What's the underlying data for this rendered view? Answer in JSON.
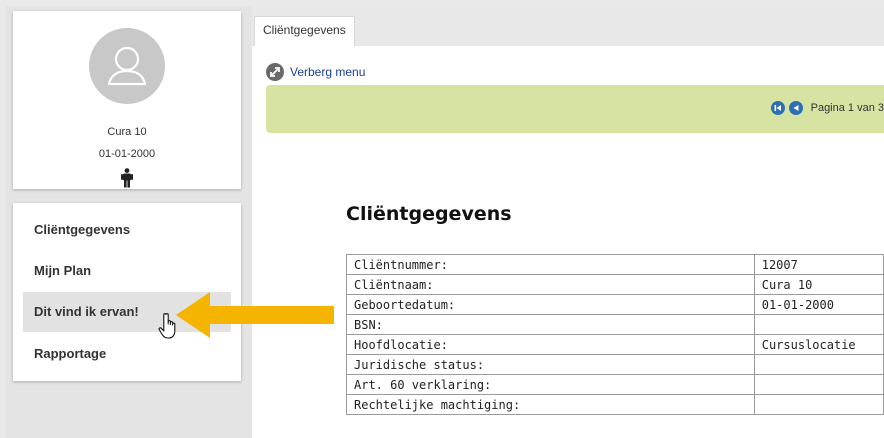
{
  "profile": {
    "name": "Cura 10",
    "dob": "01-01-2000",
    "gender_icon": "male-figure-icon"
  },
  "sidebar": {
    "items": [
      {
        "label": "Cliëntgegevens",
        "active": false
      },
      {
        "label": "Mijn Plan",
        "active": false
      },
      {
        "label": "Dit vind ik ervan!",
        "active": true
      },
      {
        "label": "Rapportage",
        "active": false
      }
    ]
  },
  "tabs": [
    {
      "label": "Cliëntgegevens"
    }
  ],
  "toolbar": {
    "hide_menu_label": "Verberg menu",
    "page_label": "Pagina 1 van 3"
  },
  "content": {
    "title": "Cliëntgegevens",
    "rows": [
      {
        "key": "Cliëntnummer:",
        "value": "12007"
      },
      {
        "key": "Cliëntnaam:",
        "value": "Cura 10"
      },
      {
        "key": "Geboortedatum:",
        "value": "01-01-2000"
      },
      {
        "key": "BSN:",
        "value": ""
      },
      {
        "key": "Hoofdlocatie:",
        "value": "Cursuslocatie"
      },
      {
        "key": "Juridische status:",
        "value": ""
      },
      {
        "key": "Art. 60 verklaring:",
        "value": ""
      },
      {
        "key": "Rechtelijke machtiging:",
        "value": ""
      }
    ]
  },
  "colors": {
    "accent_green": "#d6e3a3",
    "arrow": "#f5b400",
    "link": "#1a3f9e",
    "pager_blue": "#2c6fb5"
  }
}
